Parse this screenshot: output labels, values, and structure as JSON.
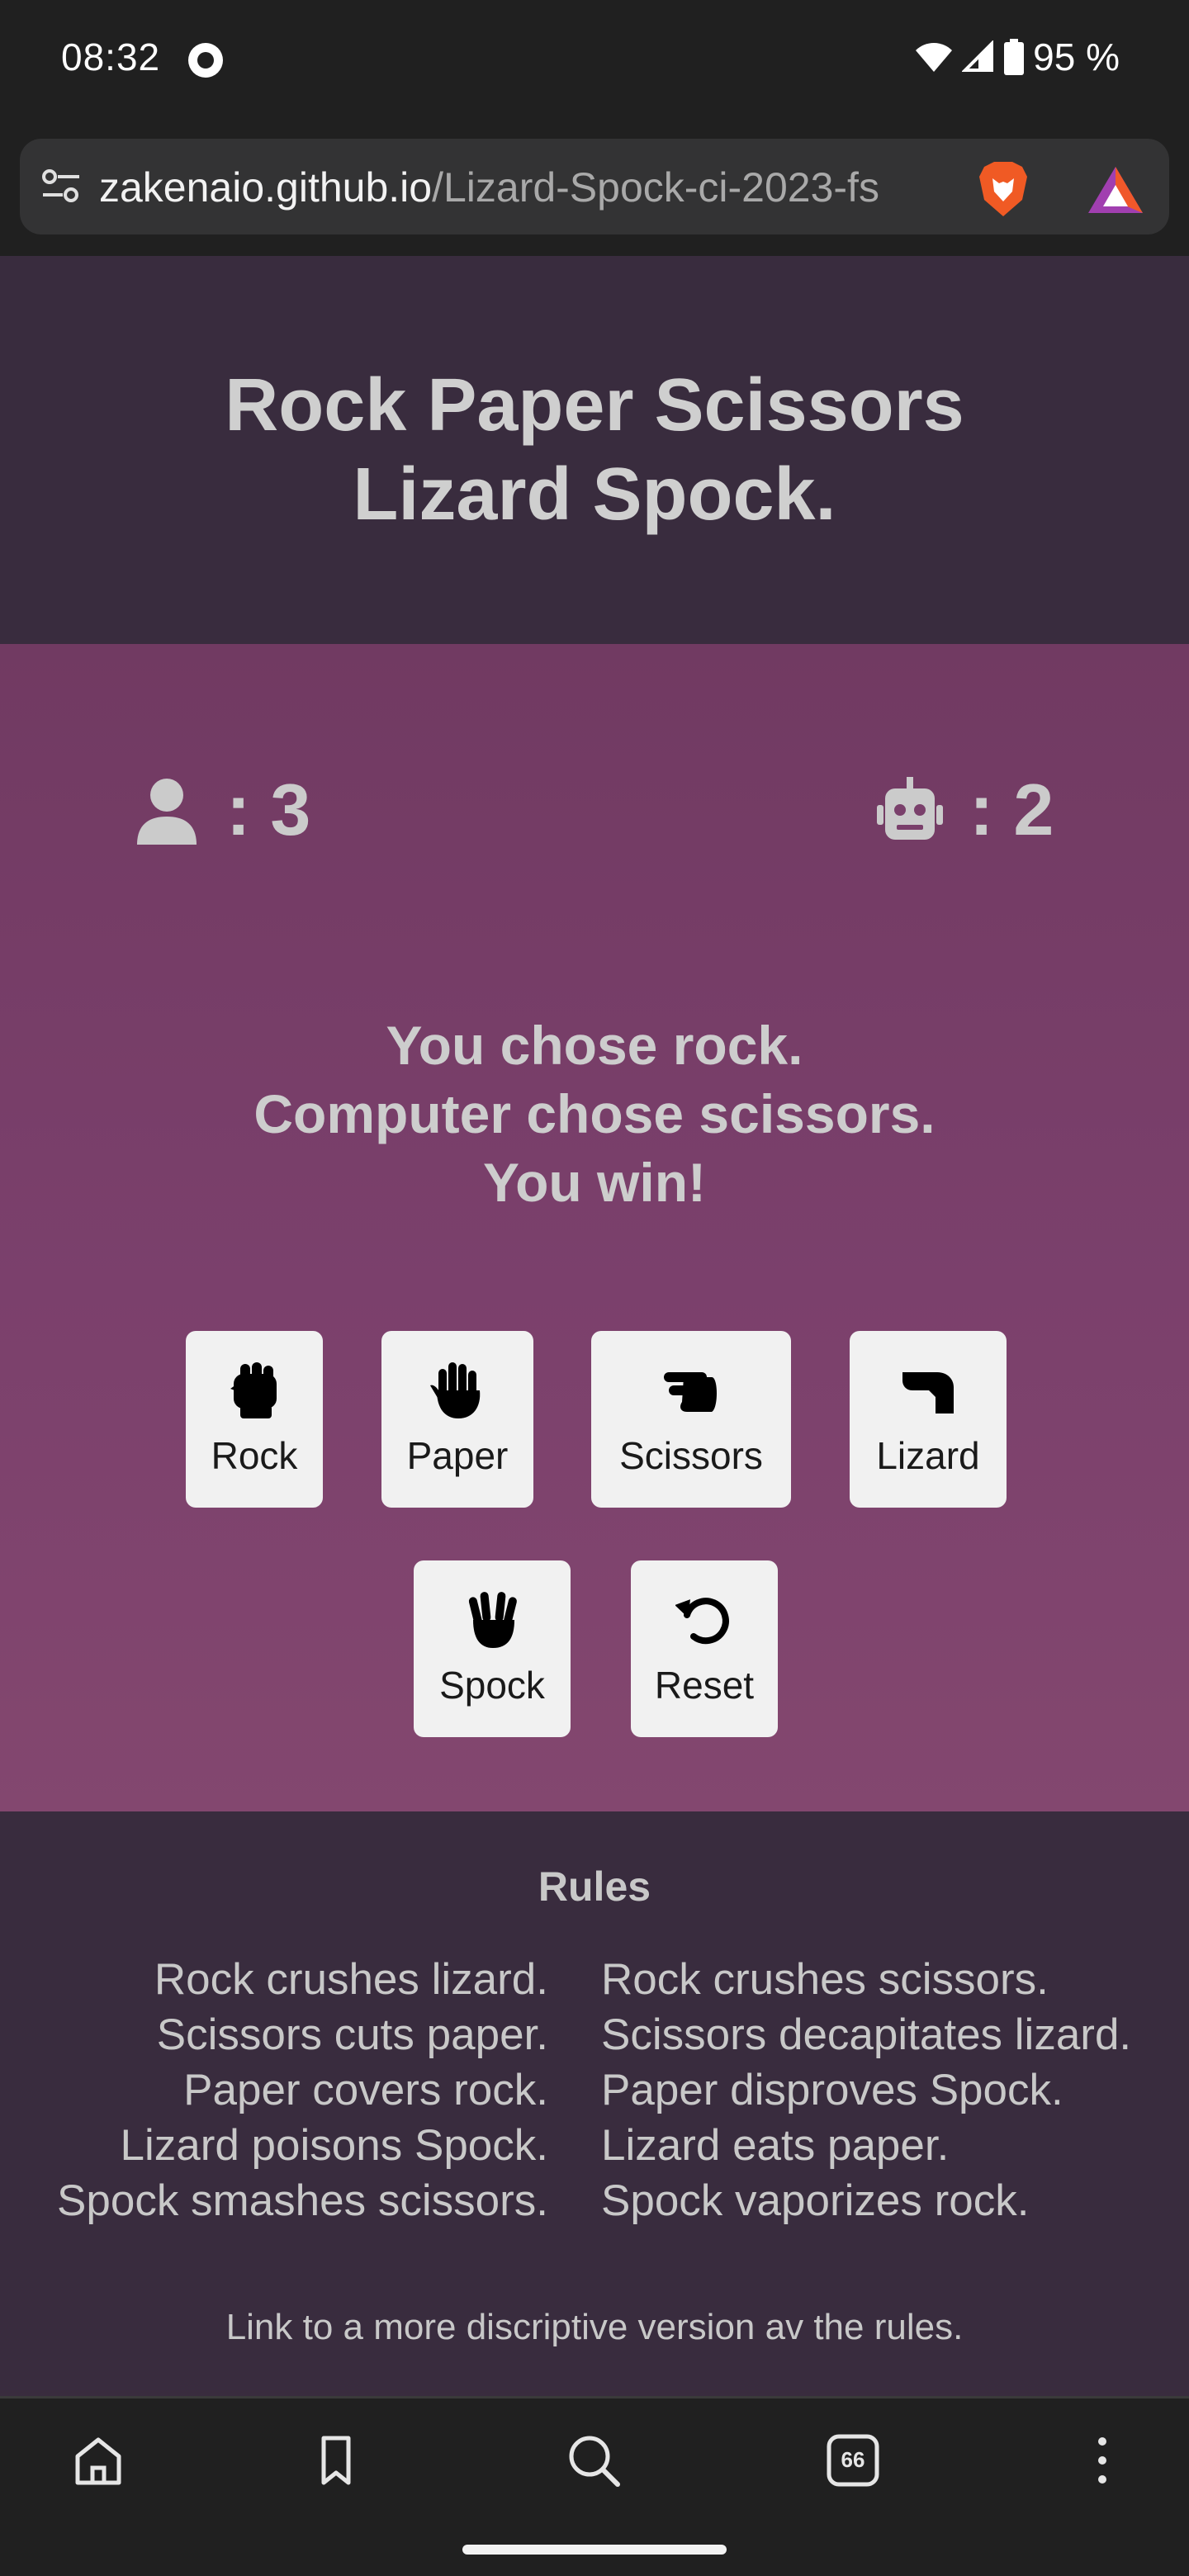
{
  "status_bar": {
    "time": "08:32",
    "battery": "95 %",
    "icons": [
      "record-dot-icon",
      "wifi-icon",
      "cell-signal-icon",
      "battery-icon"
    ]
  },
  "browser": {
    "url_host": "zakenaio.github.io",
    "url_path": "/Lizard-Spock-ci-2023-fs",
    "icons": [
      "site-settings-icon",
      "brave-shields-icon",
      "brave-rewards-icon"
    ],
    "tab_count": "66",
    "nav_icons": [
      "home-icon",
      "bookmark-icon",
      "search-icon",
      "tabs-icon",
      "more-menu-icon"
    ]
  },
  "header": {
    "title_line1": "Rock Paper Scissors",
    "title_line2": "Lizard Spock."
  },
  "scores": {
    "player_icon": "user-icon",
    "player": "3",
    "computer_icon": "robot-icon",
    "computer": "2",
    "separator": ":"
  },
  "result": {
    "line1": "You chose rock.",
    "line2": "Computer chose scissors.",
    "line3": "You win!"
  },
  "choices": {
    "rock": "Rock",
    "paper": "Paper",
    "scissors": "Scissors",
    "lizard": "Lizard",
    "spock": "Spock",
    "reset": "Reset"
  },
  "rules": {
    "title": "Rules",
    "left": [
      "Rock crushes lizard.",
      "Scissors cuts paper.",
      "Paper covers rock.",
      "Lizard poisons Spock.",
      "Spock smashes scissors."
    ],
    "right": [
      "Rock crushes scissors.",
      "Scissors decapitates lizard.",
      "Paper disproves Spock.",
      "Lizard eats paper.",
      "Spock vaporizes rock."
    ],
    "link": "Link to a more discriptive version av the rules."
  },
  "colors": {
    "header_bg": "#392c3e",
    "game_bg": "#7b406c",
    "button_bg": "#f1f1f1",
    "text_light": "#cdcdcd"
  }
}
